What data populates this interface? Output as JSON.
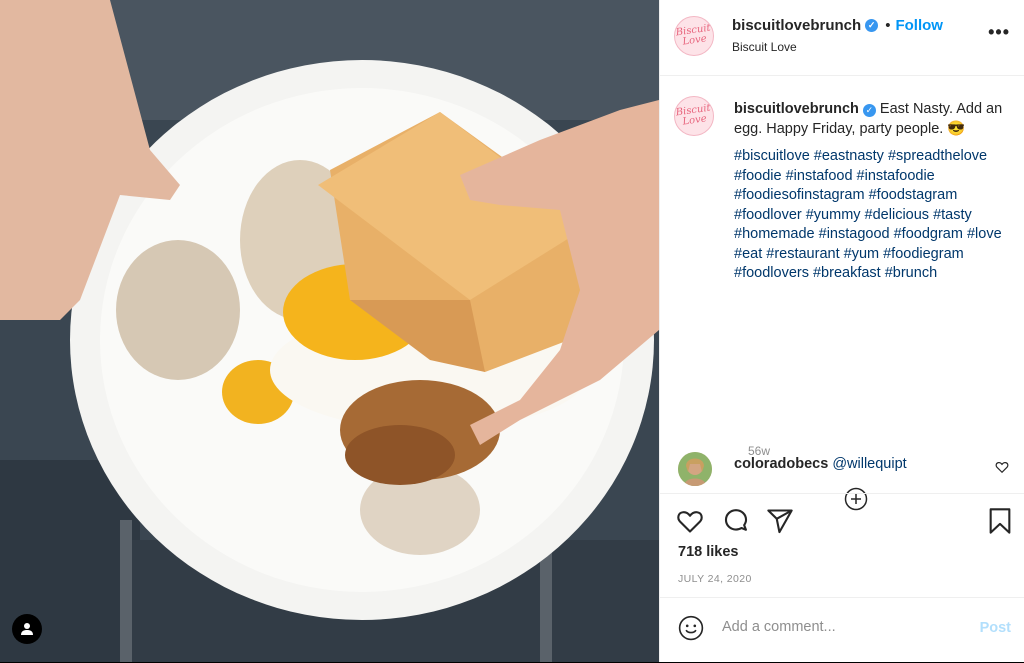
{
  "post": {
    "username": "biscuitlovebrunch",
    "location": "Biscuit Love",
    "follow_label": "Follow",
    "more_label": "•••",
    "avatar_text": "Biscuit Love",
    "caption_text": "East Nasty. Add an egg. Happy Friday, party people. 😎",
    "hashtags": "#biscuitlove #eastnasty #spreadthelove #foodie #instafood #instafoodie #foodiesofinstagram #foodstagram #foodlover #yummy #delicious #tasty #homemade #instagood #foodgram #love #eat #restaurant #yum #foodiegram #foodlovers #breakfast #brunch",
    "age": "56w",
    "likes": "718 likes",
    "date": "JULY 24, 2020"
  },
  "comment": {
    "username": "coloradobecs",
    "mention": "@willequipt"
  },
  "add_comment": {
    "placeholder": "Add a comment...",
    "post_label": "Post"
  },
  "colors": {
    "accent": "#0095f6",
    "hashtag": "#00376b",
    "muted": "#8e8e8e"
  },
  "icons": [
    "user-icon",
    "verified-icon",
    "more-icon",
    "add-circle-icon",
    "heart-icon",
    "comment-icon",
    "share-icon",
    "bookmark-icon",
    "emoji-icon"
  ]
}
